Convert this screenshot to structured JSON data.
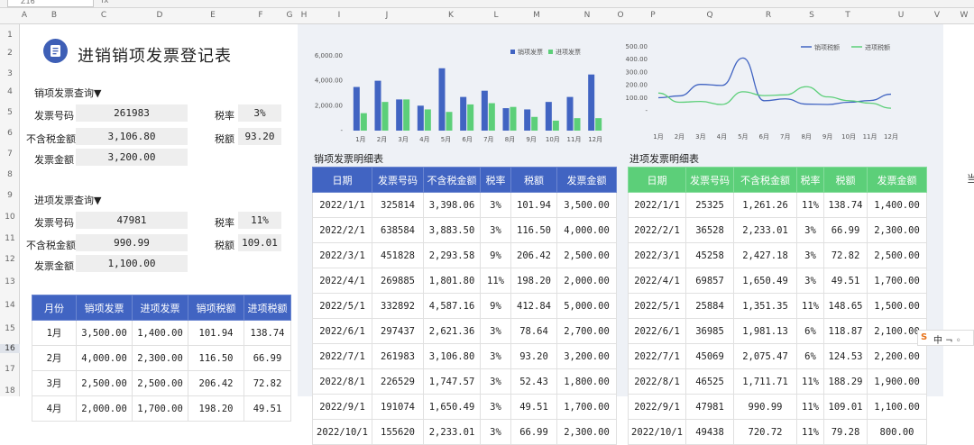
{
  "toolbar": {
    "namebox": "Z16",
    "fx": "fx"
  },
  "columns": [
    "A",
    "B",
    "C",
    "D",
    "E",
    "F",
    "G",
    "H",
    "I",
    "J",
    "K",
    "L",
    "M",
    "N",
    "O",
    "P",
    "Q",
    "R",
    "S",
    "T",
    "U",
    "V",
    "W",
    "X"
  ],
  "rows": [
    "1",
    "2",
    "3",
    "4",
    "5",
    "6",
    "7",
    "8",
    "9",
    "10",
    "11",
    "12",
    "13",
    "14",
    "15",
    "16",
    "17",
    "18"
  ],
  "title": "进销销项发票登记表",
  "sales_query": {
    "heading": "销项发票查询▼",
    "invoice_no_label": "发票号码",
    "invoice_no": "261983",
    "tax_rate_label": "税率",
    "tax_rate": "3%",
    "net_label": "不含税金额",
    "net": "3,106.80",
    "tax_label": "税额",
    "tax": "93.20",
    "amount_label": "发票金额",
    "amount": "3,200.00"
  },
  "purchase_query": {
    "heading": "进项发票查询▼",
    "invoice_no_label": "发票号码",
    "invoice_no": "47981",
    "tax_rate_label": "税率",
    "tax_rate": "11%",
    "net_label": "不含税金额",
    "net": "990.99",
    "tax_label": "税额",
    "tax": "109.01",
    "amount_label": "发票金额",
    "amount": "1,100.00"
  },
  "summary": {
    "headers": [
      "月份",
      "销项发票",
      "进项发票",
      "销项税额",
      "进项税额"
    ],
    "rows": [
      [
        "1月",
        "3,500.00",
        "1,400.00",
        "101.94",
        "138.74"
      ],
      [
        "2月",
        "4,000.00",
        "2,300.00",
        "116.50",
        "66.99"
      ],
      [
        "3月",
        "2,500.00",
        "2,500.00",
        "206.42",
        "72.82"
      ],
      [
        "4月",
        "2,000.00",
        "1,700.00",
        "198.20",
        "49.51"
      ]
    ]
  },
  "sales_detail": {
    "title": "销项发票明细表",
    "headers": [
      "日期",
      "发票号码",
      "不含税金额",
      "税率",
      "税额",
      "发票金额"
    ],
    "rows": [
      [
        "2022/1/1",
        "325814",
        "3,398.06",
        "3%",
        "101.94",
        "3,500.00"
      ],
      [
        "2022/2/1",
        "638584",
        "3,883.50",
        "3%",
        "116.50",
        "4,000.00"
      ],
      [
        "2022/3/1",
        "451828",
        "2,293.58",
        "9%",
        "206.42",
        "2,500.00"
      ],
      [
        "2022/4/1",
        "269885",
        "1,801.80",
        "11%",
        "198.20",
        "2,000.00"
      ],
      [
        "2022/5/1",
        "332892",
        "4,587.16",
        "9%",
        "412.84",
        "5,000.00"
      ],
      [
        "2022/6/1",
        "297437",
        "2,621.36",
        "3%",
        "78.64",
        "2,700.00"
      ],
      [
        "2022/7/1",
        "261983",
        "3,106.80",
        "3%",
        "93.20",
        "3,200.00"
      ],
      [
        "2022/8/1",
        "226529",
        "1,747.57",
        "3%",
        "52.43",
        "1,800.00"
      ],
      [
        "2022/9/1",
        "191074",
        "1,650.49",
        "3%",
        "49.51",
        "1,700.00"
      ],
      [
        "2022/10/1",
        "155620",
        "2,233.01",
        "3%",
        "66.99",
        "2,300.00"
      ]
    ]
  },
  "purchase_detail": {
    "title": "进项发票明细表",
    "headers": [
      "日期",
      "发票号码",
      "不含税金额",
      "税率",
      "税额",
      "发票金额"
    ],
    "rows": [
      [
        "2022/1/1",
        "25325",
        "1,261.26",
        "11%",
        "138.74",
        "1,400.00"
      ],
      [
        "2022/2/1",
        "36528",
        "2,233.01",
        "3%",
        "66.99",
        "2,300.00"
      ],
      [
        "2022/3/1",
        "45258",
        "2,427.18",
        "3%",
        "72.82",
        "2,500.00"
      ],
      [
        "2022/4/1",
        "69857",
        "1,650.49",
        "3%",
        "49.51",
        "1,700.00"
      ],
      [
        "2022/5/1",
        "25884",
        "1,351.35",
        "11%",
        "148.65",
        "1,500.00"
      ],
      [
        "2022/6/1",
        "36985",
        "1,981.13",
        "6%",
        "118.87",
        "2,100.00"
      ],
      [
        "2022/7/1",
        "45069",
        "2,075.47",
        "6%",
        "124.53",
        "2,200.00"
      ],
      [
        "2022/8/1",
        "46525",
        "1,711.71",
        "11%",
        "188.29",
        "1,900.00"
      ],
      [
        "2022/9/1",
        "47981",
        "990.99",
        "11%",
        "109.01",
        "1,100.00"
      ],
      [
        "2022/10/1",
        "49438",
        "720.72",
        "11%",
        "79.28",
        "800.00"
      ]
    ]
  },
  "side_text": "当",
  "ime": {
    "label": "S中 ¬ ◦"
  },
  "chart_data": [
    {
      "type": "bar",
      "categories": [
        "1月",
        "2月",
        "3月",
        "4月",
        "5月",
        "6月",
        "7月",
        "8月",
        "9月",
        "10月",
        "11月",
        "12月"
      ],
      "series": [
        {
          "name": "销项发票",
          "color": "#4164c2",
          "values": [
            3500,
            4000,
            2500,
            2000,
            5000,
            2700,
            3200,
            1800,
            1700,
            2300,
            2700,
            4500
          ]
        },
        {
          "name": "进项发票",
          "color": "#5ccf79",
          "values": [
            1400,
            2300,
            2500,
            1700,
            1500,
            2100,
            2200,
            1900,
            1100,
            800,
            1000,
            1000
          ]
        }
      ],
      "yticks": [
        "6,000.00",
        "4,000.00",
        "2,000.00",
        "-"
      ],
      "ylim": [
        0,
        6500
      ],
      "legend": "top-right"
    },
    {
      "type": "line",
      "categories": [
        "1月",
        "2月",
        "3月",
        "4月",
        "5月",
        "6月",
        "7月",
        "8月",
        "9月",
        "10月",
        "11月",
        "12月"
      ],
      "series": [
        {
          "name": "销项税额",
          "color": "#4164c2",
          "values": [
            101.94,
            116.5,
            206.42,
            198.2,
            412.84,
            78.64,
            93.2,
            52.43,
            49.51,
            66.99,
            80,
            130
          ]
        },
        {
          "name": "进项税额",
          "color": "#5ccf79",
          "values": [
            138.74,
            66.99,
            72.82,
            49.51,
            148.65,
            118.87,
            124.53,
            188.29,
            109.01,
            79.28,
            60,
            20
          ]
        }
      ],
      "yticks": [
        "500.00",
        "400.00",
        "300.00",
        "200.00",
        "100.00",
        "-"
      ],
      "ylim": [
        0,
        500
      ],
      "legend": "top-right"
    }
  ]
}
